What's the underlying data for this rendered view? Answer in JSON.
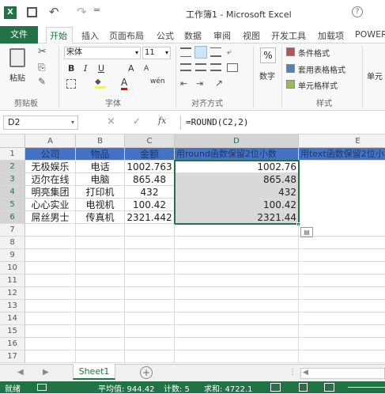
{
  "title": {
    "text": "工作簿1 - Microsoft Excel",
    "app_icon": "excel-logo-icon",
    "save_icon": "save-icon",
    "undo_icon": "undo-icon",
    "redo_icon": "redo-icon",
    "quick_access_more": "▾"
  },
  "tabs": {
    "file": "文件",
    "items": [
      "开始",
      "插入",
      "页面布局",
      "公式",
      "数据",
      "审阅",
      "视图",
      "开发工具",
      "加载项",
      "POWER"
    ]
  },
  "ribbon": {
    "clipboard": {
      "paste": "粘贴",
      "label": "剪贴板"
    },
    "font": {
      "name": "宋体",
      "size": "11",
      "bold": "B",
      "italic": "I",
      "underline": "U",
      "grow": "A",
      "shrink": "A",
      "wen": "wén",
      "color": "A",
      "label": "字体"
    },
    "align": {
      "label": "对齐方式"
    },
    "number": {
      "format": "数字",
      "percent": "%"
    },
    "styles": {
      "conditional": "条件格式",
      "table": "套用表格格式",
      "cell": "单元格样式",
      "label": "样式"
    },
    "cells": {
      "label": "单元"
    }
  },
  "formula_bar": {
    "name_box": "D2",
    "cancel": "×",
    "enter": "✓",
    "fx": "fx",
    "formula": "=ROUND(C2,2)"
  },
  "grid": {
    "columns": [
      "A",
      "B",
      "C",
      "D",
      "E"
    ],
    "row_numbers": [
      "1",
      "2",
      "3",
      "4",
      "5",
      "6",
      "7",
      "8",
      "9",
      "10",
      "11",
      "12",
      "13",
      "14",
      "15",
      "16",
      "17"
    ],
    "header_row": [
      "公司",
      "物品",
      "金额",
      "用round函数保留2位小数",
      "用text函数保留2位小"
    ],
    "rows": [
      {
        "a": "无极娱乐",
        "b": "电话",
        "c": "1002.763",
        "d": "1002.76"
      },
      {
        "a": "迈尔在线",
        "b": "电脑",
        "c": "865.48",
        "d": "865.48"
      },
      {
        "a": "明亮集团",
        "b": "打印机",
        "c": "432",
        "d": "432"
      },
      {
        "a": "心心实业",
        "b": "电视机",
        "c": "100.42",
        "d": "100.42"
      },
      {
        "a": "屌丝男士",
        "b": "传真机",
        "c": "2321.442",
        "d": "2321.44"
      }
    ]
  },
  "sheet_tabs": {
    "active": "Sheet1",
    "add": "+"
  },
  "status": {
    "mode": "就绪",
    "average": "平均值: 944.42",
    "count": "计数: 5",
    "sum": "求和: 4722.1"
  },
  "colors": {
    "excel_green": "#217346",
    "header_fill": "#4472c4",
    "selection": "#d9d9d9"
  }
}
